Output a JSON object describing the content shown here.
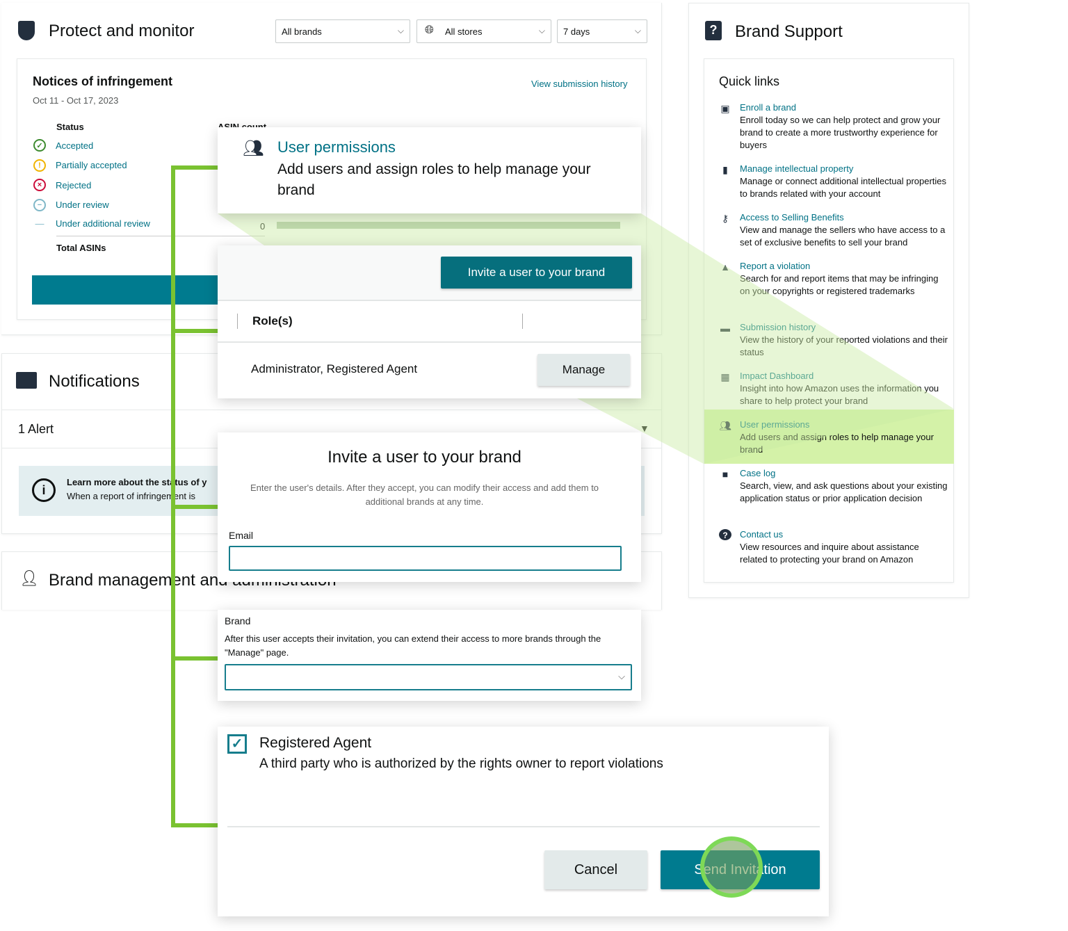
{
  "protect": {
    "title": "Protect and monitor",
    "filters": {
      "brands": "All brands",
      "stores": "All stores",
      "days": "7 days"
    },
    "notices": {
      "title": "Notices of infringement",
      "date_range": "Oct 11 - Oct 17, 2023",
      "view_history": "View submission history",
      "status_header": "Status",
      "count_header": "ASIN count",
      "statuses": [
        {
          "label": "Accepted",
          "icon": "check-circle-icon",
          "color": "#3d8b2f"
        },
        {
          "label": "Partially accepted",
          "icon": "exclamation-circle-icon",
          "color": "#f0b400"
        },
        {
          "label": "Rejected",
          "icon": "x-circle-icon",
          "color": "#cc0c39"
        },
        {
          "label": "Under review",
          "icon": "minus-circle-icon",
          "color": "#7fb7c7"
        },
        {
          "label": "Under additional review",
          "icon": "dash-icon",
          "color": "#7fb7c7"
        }
      ],
      "under_additional_count": "0",
      "total_label": "Total ASINs"
    }
  },
  "notifications": {
    "title": "Notifications",
    "alert_count": "1 Alert",
    "info_title": "Learn more about the status of y",
    "info_text": "When a report of infringement is"
  },
  "brand_mgmt": {
    "title": "Brand management and administration"
  },
  "callouts": {
    "user_permissions": {
      "title": "User permissions",
      "desc": "Add users and assign roles to help manage your brand"
    },
    "invite_button": "Invite a user to your brand",
    "roles_header": "Role(s)",
    "role_value": "Administrator, Registered Agent",
    "manage": "Manage",
    "invite_form": {
      "title": "Invite a user to your brand",
      "desc": "Enter the user's details. After they accept, you can modify their access and add them to additional brands at any time.",
      "email_label": "Email",
      "email_value": ""
    },
    "brand": {
      "label": "Brand",
      "desc": "After this user accepts their invitation, you can extend their access to more brands through the \"Manage\" page.",
      "value": ""
    },
    "role": {
      "title": "Registered Agent",
      "desc": "A third party who is authorized by the rights owner to report violations",
      "checked": true
    },
    "cancel": "Cancel",
    "send": "Send Invitation"
  },
  "support": {
    "title": "Brand Support",
    "quick_links_title": "Quick links",
    "highlight_color": "#d4f2a8",
    "links": [
      {
        "title": "Enroll a brand",
        "desc": "Enroll today so we can help protect and grow your brand to create a more trustworthy experience for buyers",
        "icon": "folder-plus-icon"
      },
      {
        "title": "Manage intellectual property",
        "desc": "Manage or connect additional intellectual properties to brands related with your account",
        "icon": "book-icon"
      },
      {
        "title": "Access to Selling Benefits",
        "desc": "View and manage the sellers who have access to a set of exclusive benefits to sell your brand",
        "icon": "key-icon"
      },
      {
        "title": "Report a violation",
        "desc": "Search for and report items that may be infringing on your copyrights or registered trademarks",
        "icon": "warning-icon"
      },
      {
        "title": "Submission history",
        "desc": "View the history of your reported violations and their status",
        "icon": "folder-icon"
      },
      {
        "title": "Impact Dashboard",
        "desc": "Insight into how Amazon uses the information you share to help protect your brand",
        "icon": "dashboard-icon"
      },
      {
        "title": "User permissions",
        "desc": "Add users and assign roles to help manage your brand",
        "icon": "users-icon",
        "highlighted": true
      },
      {
        "title": "Case log",
        "desc": "Search, view, and ask questions about your existing application status or prior application decision",
        "icon": "briefcase-icon"
      },
      {
        "title": "Contact us",
        "desc": "View resources and inquire about assistance related to protecting your brand on Amazon",
        "icon": "question-circle-icon"
      }
    ]
  }
}
